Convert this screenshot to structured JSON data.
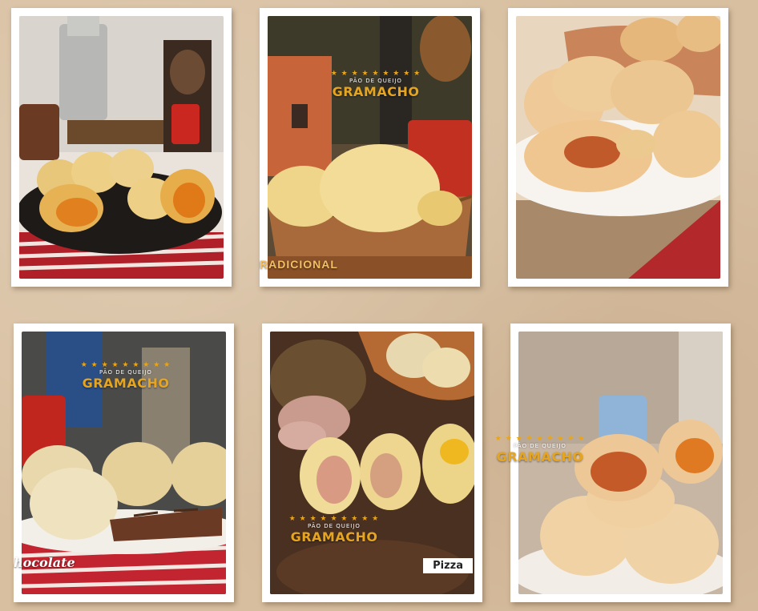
{
  "logo": {
    "stars": "★ ★ ★ ★ ★ ★ ★ ★ ★",
    "subtitle": "PÃO DE QUEIJO",
    "brand": "GRAMACHO"
  },
  "photos": [
    {
      "caption": ""
    },
    {
      "caption": "RADICIONAL"
    },
    {
      "caption": ""
    },
    {
      "caption": "hocolate"
    },
    {
      "caption": "Pizza"
    },
    {
      "caption": ""
    }
  ],
  "colors": {
    "background": "#d8bfa0",
    "card": "#ffffff",
    "brand_gold": "#e6a520"
  }
}
